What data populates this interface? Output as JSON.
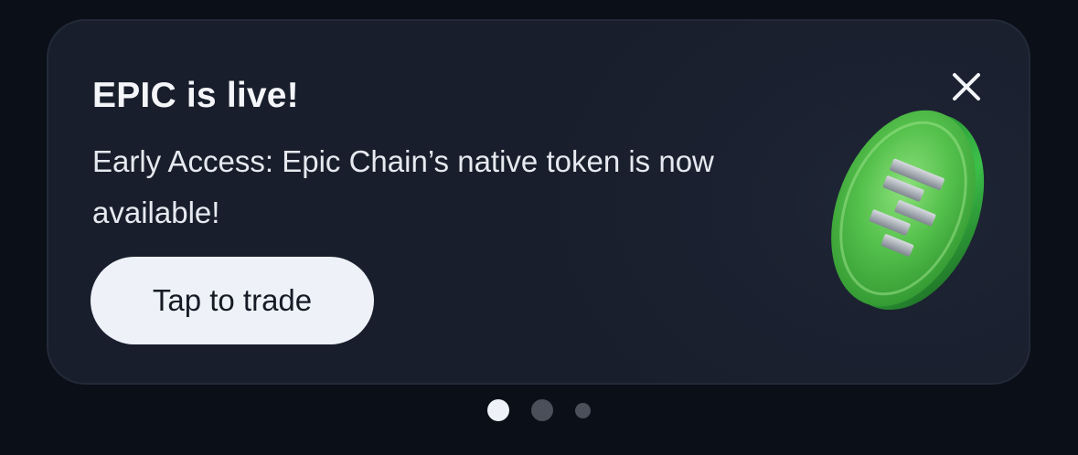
{
  "banner": {
    "title": "EPIC is live!",
    "description": "Early Access: Epic Chain’s native token is now available!",
    "cta_label": "Tap to trade",
    "close_icon": "close-icon",
    "illustration_icon": "epic-coin-icon"
  },
  "pagination": {
    "total_pages": 3,
    "active_page": 1
  },
  "colors": {
    "background": "#0b0f17",
    "card": "#181e2b",
    "button": "#eef1f8",
    "coin_green": "#3fbf4a",
    "dot_active": "#eef1f8",
    "dot_inactive": "#4a4f59"
  }
}
